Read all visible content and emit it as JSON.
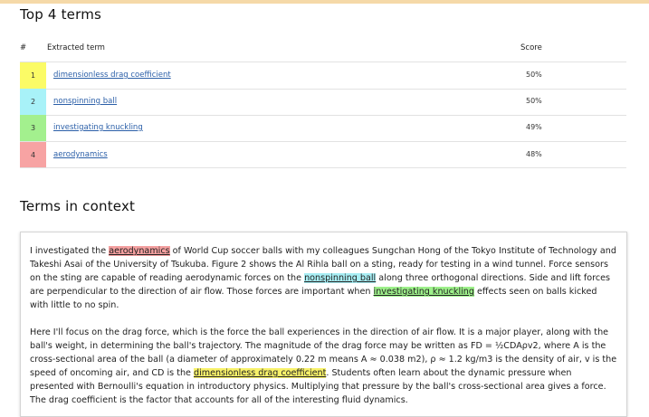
{
  "headings": {
    "top_terms": "Top 4 terms",
    "terms_in_context": "Terms in context"
  },
  "table": {
    "headers": {
      "rank": "#",
      "term": "Extracted term",
      "score": "Score"
    },
    "rows": [
      {
        "rank": "1",
        "term": "dimensionless drag coefficient",
        "score": "50%",
        "color": "#fbfb66"
      },
      {
        "rank": "2",
        "term": "nonspinning ball",
        "score": "50%",
        "color": "#a8f2f8"
      },
      {
        "rank": "3",
        "term": "investigating knuckling",
        "score": "49%",
        "color": "#a3f08e"
      },
      {
        "rank": "4",
        "term": "aerodynamics",
        "score": "48%",
        "color": "#f7a3a3"
      }
    ]
  },
  "context": {
    "p1": {
      "t1": "I investigated the ",
      "h1": "aerodynamics",
      "t2": " of World Cup soccer balls with my colleagues Sungchan Hong of the Tokyo Institute of Technology and Takeshi Asai of the University of Tsukuba. Figure 2 shows the Al Rihla ball on a sting, ready for testing in a wind tunnel. Force sensors on the sting are capable of reading aerodynamic forces on the ",
      "h2": "nonspinning ball",
      "t3": " along three orthogonal directions. Side and lift forces are perpendicular to the direction of air flow. Those forces are important when ",
      "h3": "investigating knuckling",
      "t4": " effects seen on balls kicked with little to no spin."
    },
    "p2": {
      "t1": "Here I'll focus on the drag force, which is the force the ball experiences in the direction of air flow. It is a major player, along with the ball's weight, in determining the ball's trajectory. The magnitude of the drag force may be written as FD = ½CDAρv2, where A is the cross-sectional area of the ball (a diameter of approximately 0.22 m means A ≈ 0.038 m2), ρ ≈ 1.2 kg/m3 is the density of air, v is the speed of oncoming air, and CD is the ",
      "h1": "dimensionless drag coefficient",
      "t2": ". Students often learn about the dynamic pressure when presented with Bernoulli's equation in introductory physics. Multiplying that pressure by the ball's cross-sectional area gives a force. The drag coefficient is the factor that accounts for all of the interesting fluid dynamics."
    }
  }
}
